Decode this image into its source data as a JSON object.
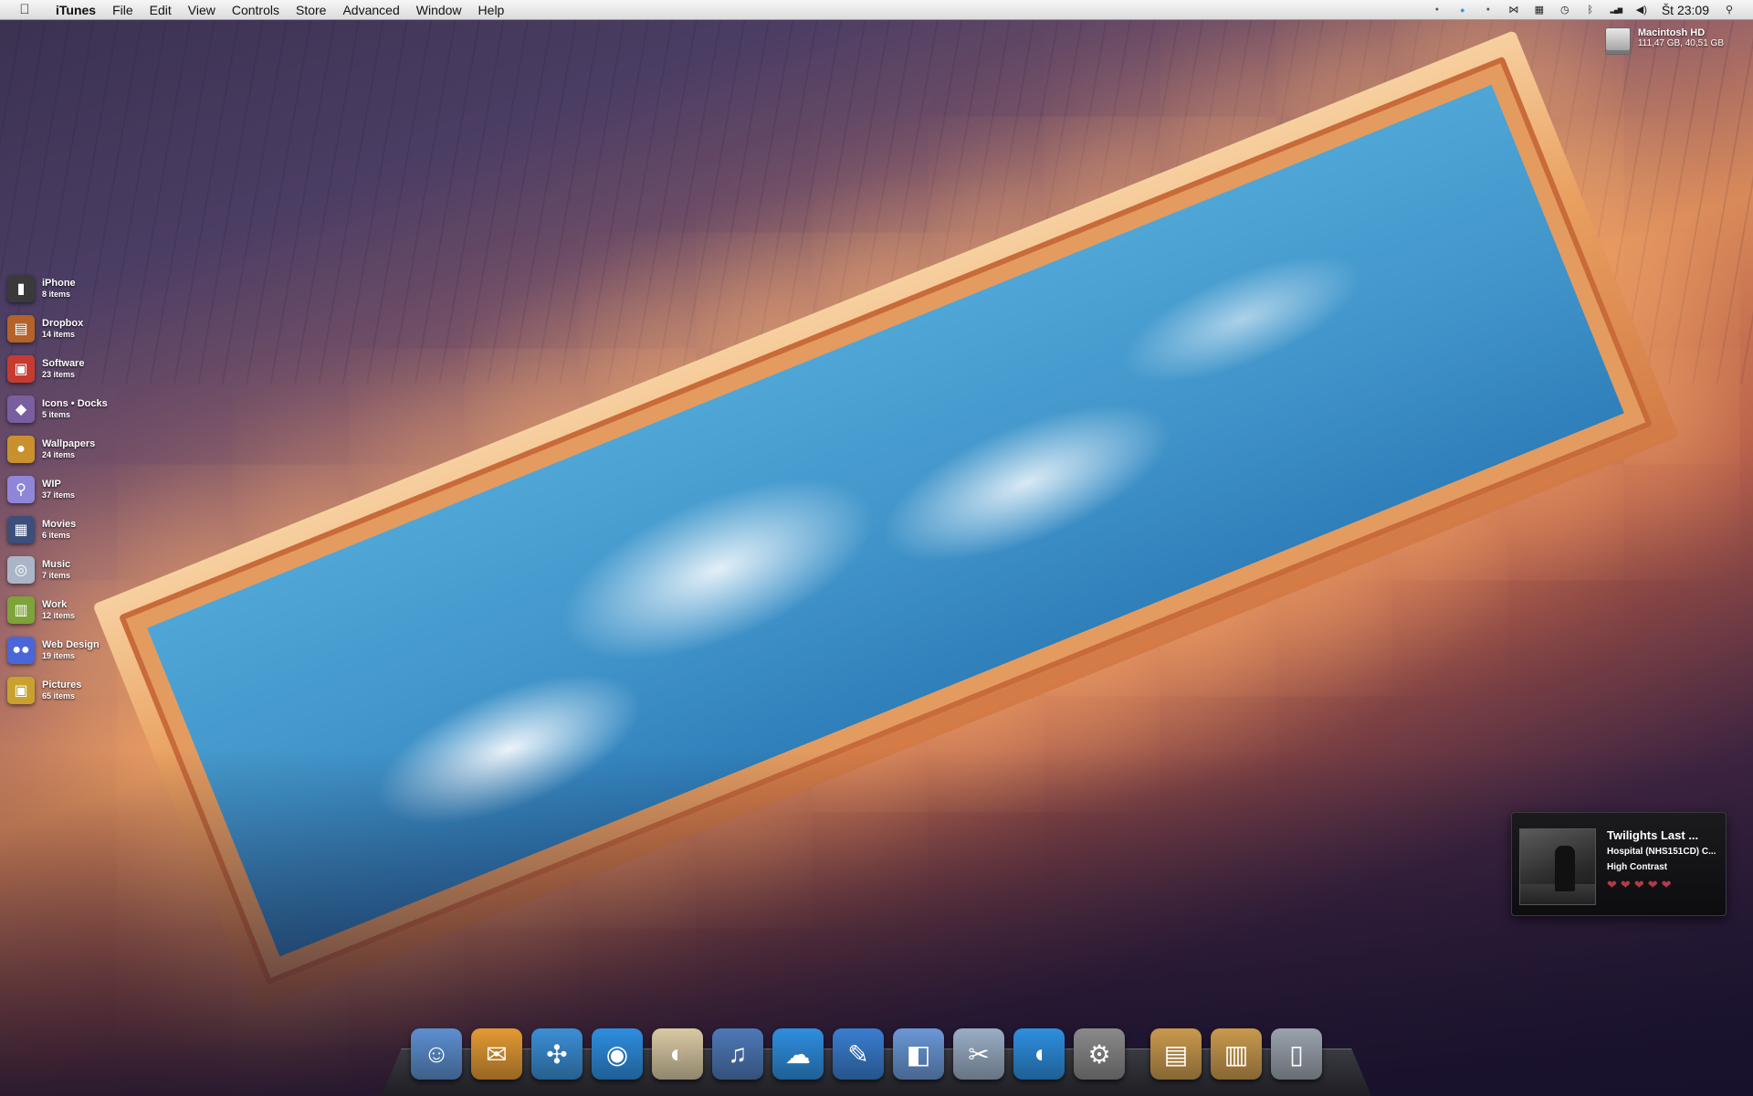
{
  "menubar": {
    "apple_icon": "apple-logo",
    "app_name": "iTunes",
    "menus": [
      "File",
      "Edit",
      "View",
      "Controls",
      "Store",
      "Advanced",
      "Window",
      "Help"
    ],
    "extras": [
      "status-dot-icon",
      "blue-dot-icon",
      "status-dot-icon",
      "butterfly-icon",
      "spaces-icon",
      "time-machine-icon",
      "bluetooth-icon",
      "wifi-bars-icon",
      "volume-icon"
    ],
    "clock": "Št 23:09",
    "spotlight_icon": "search-icon"
  },
  "disk": {
    "name": "Macintosh HD",
    "info": "111,47 GB, 40,51 GB"
  },
  "stacks": [
    {
      "name": "iPhone",
      "count": "8 items",
      "icon": "iphone-icon",
      "color": "#3a3a3a",
      "glyph": "▮"
    },
    {
      "name": "Dropbox",
      "count": "14 items",
      "icon": "drawer-icon",
      "color": "#b3622a",
      "glyph": "▤"
    },
    {
      "name": "Software",
      "count": "23 items",
      "icon": "software-icon",
      "color": "#c63b30",
      "glyph": "▣"
    },
    {
      "name": "Icons • Docks",
      "count": "5 items",
      "icon": "box-icon",
      "color": "#7a5fa0",
      "glyph": "◆"
    },
    {
      "name": "Wallpapers",
      "count": "24 items",
      "icon": "cookie-icon",
      "color": "#c9912e",
      "glyph": "●"
    },
    {
      "name": "WIP",
      "count": "37 items",
      "icon": "preview-icon",
      "color": "#8f86d8",
      "glyph": "⚲"
    },
    {
      "name": "Movies",
      "count": "6 items",
      "icon": "film-icon",
      "color": "#3d4e7a",
      "glyph": "▦"
    },
    {
      "name": "Music",
      "count": "7 items",
      "icon": "cd-icon",
      "color": "#aab6c8",
      "glyph": "◎"
    },
    {
      "name": "Work",
      "count": "12 items",
      "icon": "folder-icon",
      "color": "#7da33a",
      "glyph": "▥"
    },
    {
      "name": "Web Design",
      "count": "19 items",
      "icon": "circles-icon",
      "color": "#4a66d8",
      "glyph": "●●"
    },
    {
      "name": "Pictures",
      "count": "65 items",
      "icon": "camera-icon",
      "color": "#c9a12e",
      "glyph": "▣"
    }
  ],
  "now_playing": {
    "title": "Twilights Last ...",
    "album": "Hospital (NHS151CD) C...",
    "artist": "High Contrast",
    "rating": 5,
    "heart_glyph": "❤"
  },
  "dock": {
    "apps": [
      {
        "name": "finder-icon",
        "glyph": "☺",
        "color": "#5d8fd0"
      },
      {
        "name": "mail-icon",
        "glyph": "✉",
        "color": "#e39a34"
      },
      {
        "name": "safari-icon",
        "glyph": "✣",
        "color": "#3b8fd6"
      },
      {
        "name": "ichat-icon",
        "glyph": "◉",
        "color": "#2f8ee0"
      },
      {
        "name": "feather-app-icon",
        "glyph": "◐",
        "color": "#d9c9a4"
      },
      {
        "name": "itunes-icon",
        "glyph": "♫",
        "color": "#4e79b8"
      },
      {
        "name": "cloud-app-icon",
        "glyph": "☁",
        "color": "#2f8fe0"
      },
      {
        "name": "feather-icon",
        "glyph": "✎",
        "color": "#3a7ed0"
      },
      {
        "name": "preview-icon",
        "glyph": "◧",
        "color": "#6b98d6"
      },
      {
        "name": "scrapbook-icon",
        "glyph": "✂",
        "color": "#9aaec4"
      },
      {
        "name": "dropzone-icon",
        "glyph": "◖",
        "color": "#2f8fe0"
      },
      {
        "name": "system-preferences-icon",
        "glyph": "⚙",
        "color": "#8a8a8a"
      }
    ],
    "stacks": [
      {
        "name": "downloads-stack-icon",
        "glyph": "▤",
        "color": "#c99a4e"
      },
      {
        "name": "documents-stack-icon",
        "glyph": "▥",
        "color": "#c99a4e"
      },
      {
        "name": "trash-icon",
        "glyph": "▯",
        "color": "#9aa3ad"
      }
    ]
  }
}
